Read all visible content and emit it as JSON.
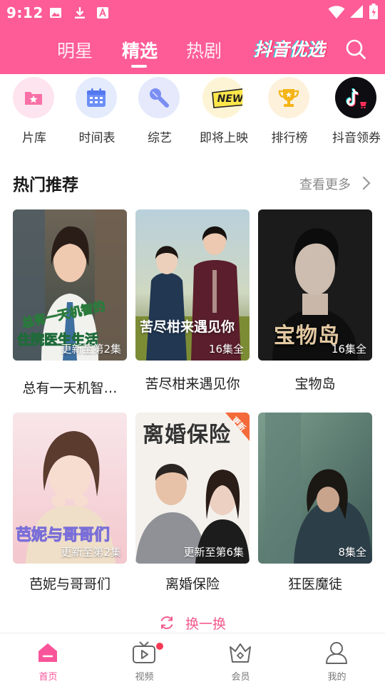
{
  "status_bar": {
    "time": "9:12",
    "icons": [
      "image-icon",
      "download-icon",
      "a-notification-icon",
      "wifi-icon",
      "signal-icon",
      "battery-icon"
    ]
  },
  "header": {
    "tabs": [
      {
        "label": "明星",
        "selected": false
      },
      {
        "label": "精选",
        "selected": true
      },
      {
        "label": "热剧",
        "selected": false
      }
    ],
    "brand_label": "抖音优选",
    "accent_color": "#fd5c96"
  },
  "categories": [
    {
      "label": "片库",
      "icon": "film-library-icon"
    },
    {
      "label": "时间表",
      "icon": "calendar-icon"
    },
    {
      "label": "综艺",
      "icon": "microphone-icon"
    },
    {
      "label": "即将上映",
      "icon": "new-badge-icon",
      "icon_text": "NEW"
    },
    {
      "label": "排行榜",
      "icon": "trophy-icon"
    },
    {
      "label": "抖音领券",
      "icon": "tiktok-icon"
    }
  ],
  "section": {
    "title": "热门推荐",
    "more_label": "查看更多"
  },
  "cards": [
    {
      "title": "总有一天机智…",
      "episodes": "更新至第2集",
      "poster_text": [
        "总有一天机智的",
        "住院医生生活"
      ]
    },
    {
      "title": "苦尽柑来遇见你",
      "episodes": "16集全",
      "poster_text": [
        "苦尽柑来遇见你"
      ]
    },
    {
      "title": "宝物岛",
      "episodes": "16集全",
      "poster_text": [
        "宝物岛"
      ]
    },
    {
      "title": "芭妮与哥哥们",
      "episodes": "更新至第2集",
      "poster_text": [
        "芭妮与哥哥们"
      ]
    },
    {
      "title": "离婚保险",
      "episodes": "更新至第6集",
      "poster_text": [
        "离婚保险",
        "更新"
      ]
    },
    {
      "title": "狂医魔徒",
      "episodes": "8集全",
      "poster_text": []
    }
  ],
  "refresh_label": "换一换",
  "bottom_nav": [
    {
      "label": "首页",
      "icon": "home-icon",
      "active": true
    },
    {
      "label": "视频",
      "icon": "tv-icon",
      "active": false,
      "has_dot": true
    },
    {
      "label": "会员",
      "icon": "crown-icon",
      "active": false
    },
    {
      "label": "我的",
      "icon": "user-icon",
      "active": false
    }
  ]
}
